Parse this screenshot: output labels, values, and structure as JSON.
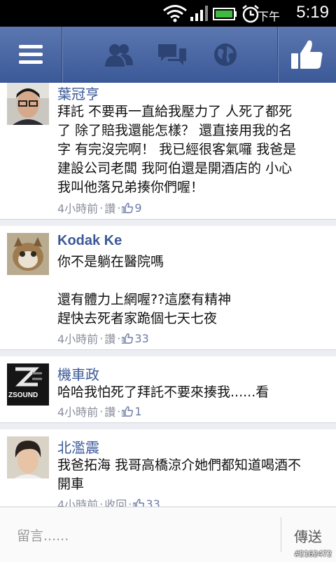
{
  "statusbar": {
    "ampm": "下午",
    "time": "5:19"
  },
  "nav": {
    "menu_icon": "hamburger-icon",
    "friends_icon": "friends-icon",
    "messages_icon": "messages-icon",
    "globe_icon": "globe-icon",
    "like_icon": "thumbs-up-icon"
  },
  "comments": [
    {
      "name": "葉冠亨",
      "text": "拜託 不要再一直給我壓力了 人死了都死\n了 除了賠我還能怎樣？ 還直接用我的名\n字 有完沒完啊！ 我已經很客氣囉 我爸是\n建設公司老闆 我阿伯還是開酒店的 小心\n我叫他落兄弟揍你們喔！",
      "time": "4小時前",
      "action": "讚",
      "likes": "9"
    },
    {
      "name": "Kodak Ke",
      "text": "你不是躺在醫院嗎\n\n還有體力上網喔??這麼有精神\n趕快去死者家跪個七天七夜",
      "time": "4小時前",
      "action": "讚",
      "likes": "33"
    },
    {
      "name": "機車政",
      "text": "哈哈我怕死了拜託不要來揍我......看",
      "time": "4小時前",
      "action": "讚",
      "likes": "1",
      "avatar_text": "ZSOUND"
    },
    {
      "name": "北濫震",
      "text": "我爸拓海 我哥高橋涼介她們都知道喝酒不\n開車",
      "time": "4小時前",
      "action": "收回",
      "likes": "33"
    }
  ],
  "composer": {
    "placeholder": "留言......",
    "send_label": "傳送"
  },
  "watermark": "#2162472",
  "colors": {
    "nav": "#3b5998",
    "name": "#3b5998",
    "meta": "#8a8f9c"
  }
}
